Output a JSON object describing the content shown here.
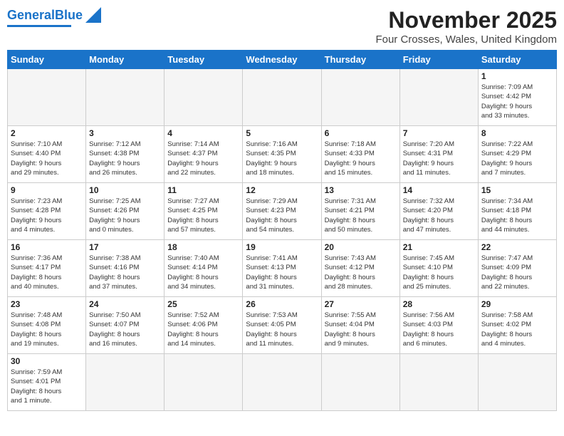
{
  "header": {
    "logo_general": "General",
    "logo_blue": "Blue",
    "month": "November 2025",
    "location": "Four Crosses, Wales, United Kingdom"
  },
  "days_of_week": [
    "Sunday",
    "Monday",
    "Tuesday",
    "Wednesday",
    "Thursday",
    "Friday",
    "Saturday"
  ],
  "weeks": [
    [
      {
        "day": "",
        "empty": true
      },
      {
        "day": "",
        "empty": true
      },
      {
        "day": "",
        "empty": true
      },
      {
        "day": "",
        "empty": true
      },
      {
        "day": "",
        "empty": true
      },
      {
        "day": "",
        "empty": true
      },
      {
        "day": "1",
        "info": "Sunrise: 7:09 AM\nSunset: 4:42 PM\nDaylight: 9 hours\nand 33 minutes."
      }
    ],
    [
      {
        "day": "2",
        "info": "Sunrise: 7:10 AM\nSunset: 4:40 PM\nDaylight: 9 hours\nand 29 minutes."
      },
      {
        "day": "3",
        "info": "Sunrise: 7:12 AM\nSunset: 4:38 PM\nDaylight: 9 hours\nand 26 minutes."
      },
      {
        "day": "4",
        "info": "Sunrise: 7:14 AM\nSunset: 4:37 PM\nDaylight: 9 hours\nand 22 minutes."
      },
      {
        "day": "5",
        "info": "Sunrise: 7:16 AM\nSunset: 4:35 PM\nDaylight: 9 hours\nand 18 minutes."
      },
      {
        "day": "6",
        "info": "Sunrise: 7:18 AM\nSunset: 4:33 PM\nDaylight: 9 hours\nand 15 minutes."
      },
      {
        "day": "7",
        "info": "Sunrise: 7:20 AM\nSunset: 4:31 PM\nDaylight: 9 hours\nand 11 minutes."
      },
      {
        "day": "8",
        "info": "Sunrise: 7:22 AM\nSunset: 4:29 PM\nDaylight: 9 hours\nand 7 minutes."
      }
    ],
    [
      {
        "day": "9",
        "info": "Sunrise: 7:23 AM\nSunset: 4:28 PM\nDaylight: 9 hours\nand 4 minutes."
      },
      {
        "day": "10",
        "info": "Sunrise: 7:25 AM\nSunset: 4:26 PM\nDaylight: 9 hours\nand 0 minutes."
      },
      {
        "day": "11",
        "info": "Sunrise: 7:27 AM\nSunset: 4:25 PM\nDaylight: 8 hours\nand 57 minutes."
      },
      {
        "day": "12",
        "info": "Sunrise: 7:29 AM\nSunset: 4:23 PM\nDaylight: 8 hours\nand 54 minutes."
      },
      {
        "day": "13",
        "info": "Sunrise: 7:31 AM\nSunset: 4:21 PM\nDaylight: 8 hours\nand 50 minutes."
      },
      {
        "day": "14",
        "info": "Sunrise: 7:32 AM\nSunset: 4:20 PM\nDaylight: 8 hours\nand 47 minutes."
      },
      {
        "day": "15",
        "info": "Sunrise: 7:34 AM\nSunset: 4:18 PM\nDaylight: 8 hours\nand 44 minutes."
      }
    ],
    [
      {
        "day": "16",
        "info": "Sunrise: 7:36 AM\nSunset: 4:17 PM\nDaylight: 8 hours\nand 40 minutes."
      },
      {
        "day": "17",
        "info": "Sunrise: 7:38 AM\nSunset: 4:16 PM\nDaylight: 8 hours\nand 37 minutes."
      },
      {
        "day": "18",
        "info": "Sunrise: 7:40 AM\nSunset: 4:14 PM\nDaylight: 8 hours\nand 34 minutes."
      },
      {
        "day": "19",
        "info": "Sunrise: 7:41 AM\nSunset: 4:13 PM\nDaylight: 8 hours\nand 31 minutes."
      },
      {
        "day": "20",
        "info": "Sunrise: 7:43 AM\nSunset: 4:12 PM\nDaylight: 8 hours\nand 28 minutes."
      },
      {
        "day": "21",
        "info": "Sunrise: 7:45 AM\nSunset: 4:10 PM\nDaylight: 8 hours\nand 25 minutes."
      },
      {
        "day": "22",
        "info": "Sunrise: 7:47 AM\nSunset: 4:09 PM\nDaylight: 8 hours\nand 22 minutes."
      }
    ],
    [
      {
        "day": "23",
        "info": "Sunrise: 7:48 AM\nSunset: 4:08 PM\nDaylight: 8 hours\nand 19 minutes."
      },
      {
        "day": "24",
        "info": "Sunrise: 7:50 AM\nSunset: 4:07 PM\nDaylight: 8 hours\nand 16 minutes."
      },
      {
        "day": "25",
        "info": "Sunrise: 7:52 AM\nSunset: 4:06 PM\nDaylight: 8 hours\nand 14 minutes."
      },
      {
        "day": "26",
        "info": "Sunrise: 7:53 AM\nSunset: 4:05 PM\nDaylight: 8 hours\nand 11 minutes."
      },
      {
        "day": "27",
        "info": "Sunrise: 7:55 AM\nSunset: 4:04 PM\nDaylight: 8 hours\nand 9 minutes."
      },
      {
        "day": "28",
        "info": "Sunrise: 7:56 AM\nSunset: 4:03 PM\nDaylight: 8 hours\nand 6 minutes."
      },
      {
        "day": "29",
        "info": "Sunrise: 7:58 AM\nSunset: 4:02 PM\nDaylight: 8 hours\nand 4 minutes."
      }
    ],
    [
      {
        "day": "30",
        "info": "Sunrise: 7:59 AM\nSunset: 4:01 PM\nDaylight: 8 hours\nand 1 minute."
      },
      {
        "day": "",
        "empty": true
      },
      {
        "day": "",
        "empty": true
      },
      {
        "day": "",
        "empty": true
      },
      {
        "day": "",
        "empty": true
      },
      {
        "day": "",
        "empty": true
      },
      {
        "day": "",
        "empty": true
      }
    ]
  ]
}
